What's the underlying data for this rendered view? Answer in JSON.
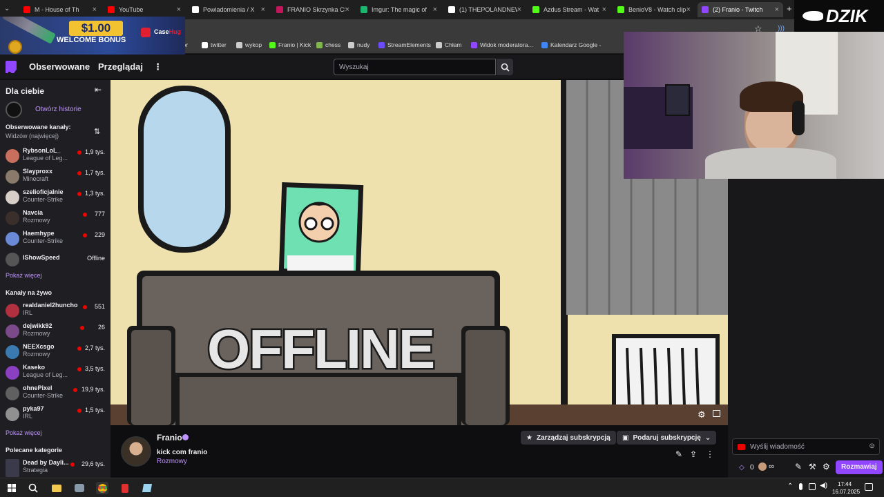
{
  "browser": {
    "tabs": [
      {
        "title": "M - House of Th",
        "color": "#ff0000"
      },
      {
        "title": "YouTube",
        "color": "#ff0000"
      },
      {
        "title": "Powiadomienia / X",
        "color": "#ffffff"
      },
      {
        "title": "FRANIO Skrzynka CS",
        "color": "#c2185b"
      },
      {
        "title": "Imgur: The magic of",
        "color": "#1bb76e"
      },
      {
        "title": "(1) THEPOLANDNEW",
        "color": "#ffffff"
      },
      {
        "title": "Azdus Stream - Wat",
        "color": "#53fc18"
      },
      {
        "title": "BenioV8 - Watch clip",
        "color": "#53fc18"
      },
      {
        "title": "(2) Franio - Twitch",
        "color": "#9146ff"
      }
    ],
    "new_tab": "+",
    "bookmarks": [
      {
        "label": "twitter",
        "color": "#ffffff"
      },
      {
        "label": "wykop",
        "color": "#cccccc"
      },
      {
        "label": "Franio | Kick",
        "color": "#53fc18"
      },
      {
        "label": "chess",
        "color": "#81b64c"
      },
      {
        "label": "nudy",
        "color": "#cccccc"
      },
      {
        "label": "StreamElements",
        "color": "#6d4bff"
      },
      {
        "label": "Chłam",
        "color": "#cccccc"
      },
      {
        "label": "Widok moderatora...",
        "color": "#9146ff"
      },
      {
        "label": "Kalendarz Google -",
        "color": "#4285f4"
      }
    ],
    "bookmarks_cut": "alior"
  },
  "ad": {
    "amount": "$1.00",
    "text": "WELCOME BONUS",
    "brand_prefix": "Case",
    "brand_suffix": "Hug"
  },
  "watermark": "DZIK",
  "twitch": {
    "nav": {
      "following": "Obserwowane",
      "browse": "Przeglądaj",
      "search_placeholder": "Wyszukaj"
    },
    "sidebar": {
      "for_you": "Dla ciebie",
      "stories": "Otwórz historie",
      "followed_header": "Obserwowane kanały:",
      "followed_sort": "Widzów (najwięcej)",
      "followed": [
        {
          "name": "RybsonLoL_",
          "category": "League of Leg...",
          "viewers": "1,9 tys.",
          "live": true,
          "color": "#c96f5e"
        },
        {
          "name": "Slayproxx",
          "category": "Minecraft",
          "viewers": "1,7 tys.",
          "live": true,
          "color": "#8a7a6a"
        },
        {
          "name": "szelioficjalnie",
          "category": "Counter-Strike",
          "viewers": "1,3 tys.",
          "live": true,
          "color": "#d8d0c8"
        },
        {
          "name": "Navcia",
          "category": "Rozmowy",
          "viewers": "777",
          "live": true,
          "color": "#3a2f2a"
        },
        {
          "name": "Haemhype",
          "category": "Counter-Strike",
          "viewers": "229",
          "live": true,
          "color": "#6a8ad8"
        },
        {
          "name": "IShowSpeed",
          "category": "",
          "viewers": "Offline",
          "live": false,
          "color": "#555555"
        }
      ],
      "show_more": "Pokaż więcej",
      "live_header": "Kanały na żywo",
      "live": [
        {
          "name": "realdaniel2huncho",
          "category": "IRL",
          "viewers": "551",
          "color": "#b03040"
        },
        {
          "name": "dejwikk92",
          "category": "Rozmowy",
          "viewers": "26",
          "color": "#7a4a8a"
        },
        {
          "name": "NEEXcsgo",
          "category": "Rozmowy",
          "viewers": "2,7 tys.",
          "color": "#3a7ab0"
        },
        {
          "name": "Kaseko",
          "category": "League of Leg...",
          "viewers": "3,5 tys.",
          "color": "#8a40c0"
        },
        {
          "name": "ohnePixel",
          "category": "Counter-Strike",
          "viewers": "19,9 tys.",
          "color": "#606060"
        },
        {
          "name": "pyka97",
          "category": "IRL",
          "viewers": "1,5 tys.",
          "color": "#909090"
        }
      ],
      "show_more_2": "Pokaż więcej",
      "recommended_header": "Polecane kategorie",
      "recommended": [
        {
          "name": "Dead by Dayli...",
          "category": "Strategia",
          "viewers": "29,6 tys."
        }
      ]
    },
    "player": {
      "offline_text": "OFFLINE"
    },
    "channel": {
      "name": "Franio",
      "title": "kick com franio",
      "category": "Rozmowy",
      "manage_sub": "Zarządzaj subskrypcją",
      "gift_sub": "Podaruj subskrypcję"
    },
    "chat": {
      "placeholder": "Wyślij wiadomość",
      "points": "0",
      "infinite": "∞",
      "chat_button": "Rozmawiaj"
    }
  },
  "taskbar": {
    "time": "17:44",
    "date": "16.07.2025"
  }
}
